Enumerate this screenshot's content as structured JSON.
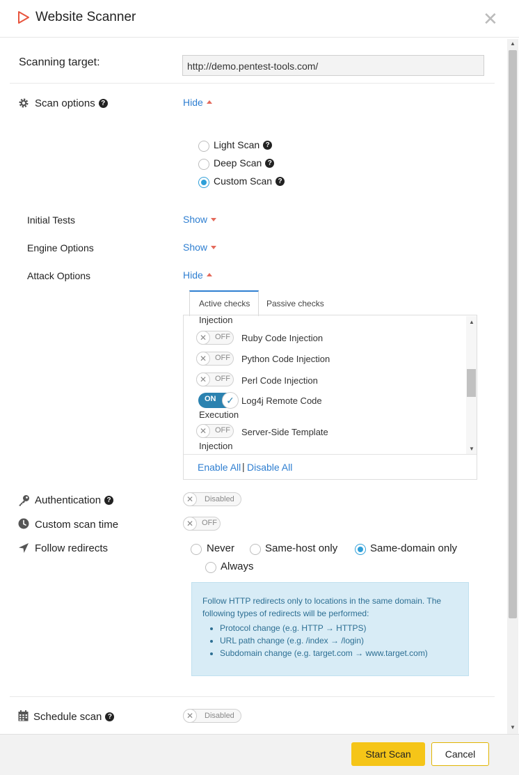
{
  "header": {
    "title": "Website Scanner",
    "logo_icon": "play-triangle-icon",
    "close_icon": "close-icon"
  },
  "target": {
    "label": "Scanning target:",
    "value": "http://demo.pentest-tools.com/"
  },
  "scan_options": {
    "label": "Scan options",
    "toggle": "Hide",
    "types": [
      {
        "label": "Light Scan",
        "selected": false
      },
      {
        "label": "Deep Scan",
        "selected": false
      },
      {
        "label": "Custom Scan",
        "selected": true
      }
    ]
  },
  "sections": {
    "initial_tests": {
      "label": "Initial Tests",
      "toggle": "Show"
    },
    "engine_options": {
      "label": "Engine Options",
      "toggle": "Show"
    },
    "attack_options": {
      "label": "Attack Options",
      "toggle": "Hide"
    }
  },
  "attack_tabs": {
    "active": "Active checks",
    "passive": "Passive checks"
  },
  "checks": {
    "partial_top": "Injection",
    "items": [
      {
        "label": "Ruby Code Injection",
        "state": "OFF"
      },
      {
        "label": "Python Code Injection",
        "state": "OFF"
      },
      {
        "label": "Perl Code Injection",
        "state": "OFF"
      },
      {
        "label": "Log4j Remote Code",
        "label_cont": "Execution",
        "state": "ON"
      },
      {
        "label": "Server-Side Template",
        "label_cont": "Injection",
        "state": "OFF"
      }
    ],
    "enable_all": "Enable All",
    "separator": "|",
    "disable_all": "Disable All"
  },
  "authentication": {
    "label": "Authentication",
    "state": "Disabled"
  },
  "custom_scan_time": {
    "label": "Custom scan time",
    "state": "OFF"
  },
  "follow_redirects": {
    "label": "Follow redirects",
    "options": [
      {
        "label": "Never",
        "selected": false
      },
      {
        "label": "Same-host only",
        "selected": false
      },
      {
        "label": "Same-domain only",
        "selected": true
      },
      {
        "label": "Always",
        "selected": false
      }
    ]
  },
  "info": {
    "text": "Follow HTTP redirects only to locations in the same domain. The following types of redirects will be performed:",
    "bullets": [
      "Protocol change (e.g. HTTP → HTTPS)",
      "URL path change (e.g. /index → /login)",
      "Subdomain change (e.g. target.com → www.target.com)"
    ]
  },
  "schedule": {
    "label": "Schedule scan",
    "state": "Disabled"
  },
  "footer": {
    "start": "Start Scan",
    "cancel": "Cancel"
  },
  "colors": {
    "accent": "#2f7fd1",
    "start_button": "#f5c518",
    "info_bg": "#d8ecf6",
    "toggle_on": "#2b82b0"
  }
}
